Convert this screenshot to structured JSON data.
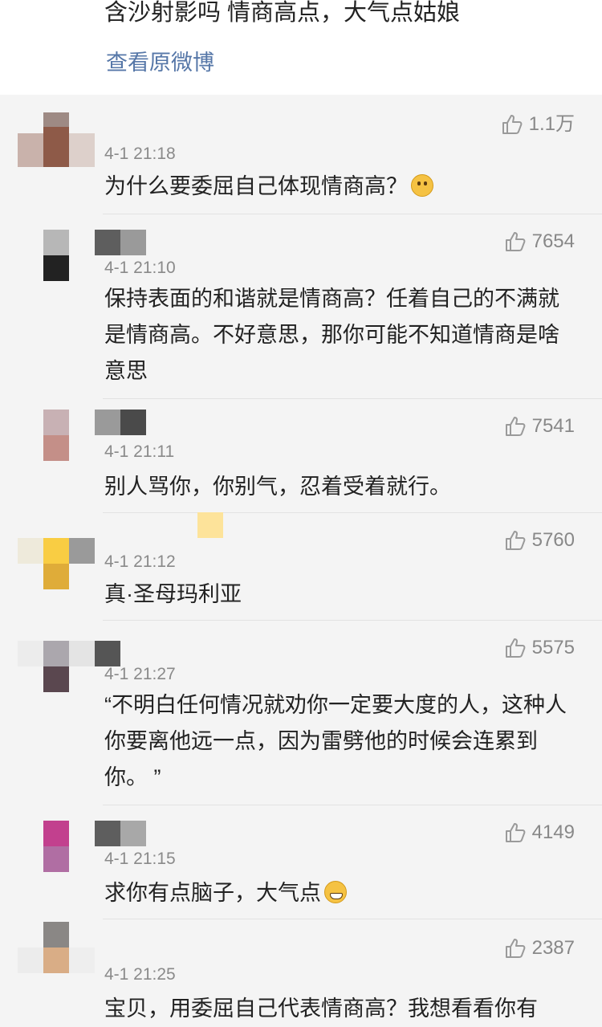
{
  "post": {
    "text": "含沙射影吗  情商高点，大气点姑娘",
    "view_original": "查看原微博"
  },
  "comments": [
    {
      "time": "4-1 21:18",
      "likes": "1.1万",
      "text": "为什么要委屈自己体现情商高？",
      "emoji": "thinking-face-icon"
    },
    {
      "time": "4-1 21:10",
      "likes": "7654",
      "text": "保持表面的和谐就是情商高？任着自己的不满就是情商高。不好意思，那你可能不知道情商是啥意思"
    },
    {
      "time": "4-1 21:11",
      "likes": "7541",
      "text": "别人骂你，你别气，忍着受着就行。"
    },
    {
      "time": "4-1 21:12",
      "likes": "5760",
      "text": "真·圣母玛利亚"
    },
    {
      "time": "4-1 21:27",
      "likes": "5575",
      "text": "“不明白任何情况就劝你一定要大度的人，这种人你要离他远一点，因为雷劈他的时候会连累到你。 ”"
    },
    {
      "time": "4-1 21:15",
      "likes": "4149",
      "text": "求你有点脑子，大气点",
      "emoji": "grinning-face-icon"
    },
    {
      "time": "4-1 21:25",
      "likes": "2387",
      "text": "宝贝，用委屈自己代表情商高？我想看看你有"
    }
  ],
  "colors": {
    "link": "#5677a8",
    "background": "#f4f4f4",
    "timestamp": "#8a8a8a"
  }
}
